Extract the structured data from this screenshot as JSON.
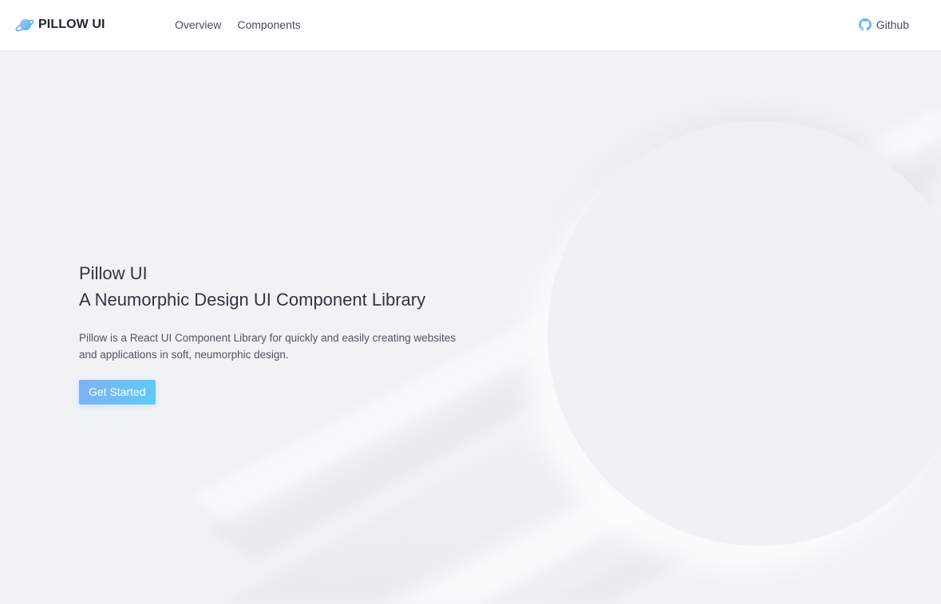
{
  "nav": {
    "brand": "PILLOW UI",
    "brand_icon": "planet-icon",
    "links": [
      {
        "label": "Overview"
      },
      {
        "label": "Components"
      }
    ],
    "github": {
      "label": "Github",
      "icon": "github-icon"
    }
  },
  "hero": {
    "title": "Pillow UI",
    "subtitle": "A Neumorphic Design UI Component Library",
    "description_line1": "Pillow is a React UI Component Library for quickly and easily creating websites",
    "description_line2": "and applications in soft, neumorphic design.",
    "cta": "Get Started"
  },
  "colors": {
    "background": "#f1f2f5",
    "nav_background": "#ffffff",
    "text": "#2f3542",
    "accent_start": "#7fb1f5",
    "accent_end": "#5fcaf6"
  }
}
